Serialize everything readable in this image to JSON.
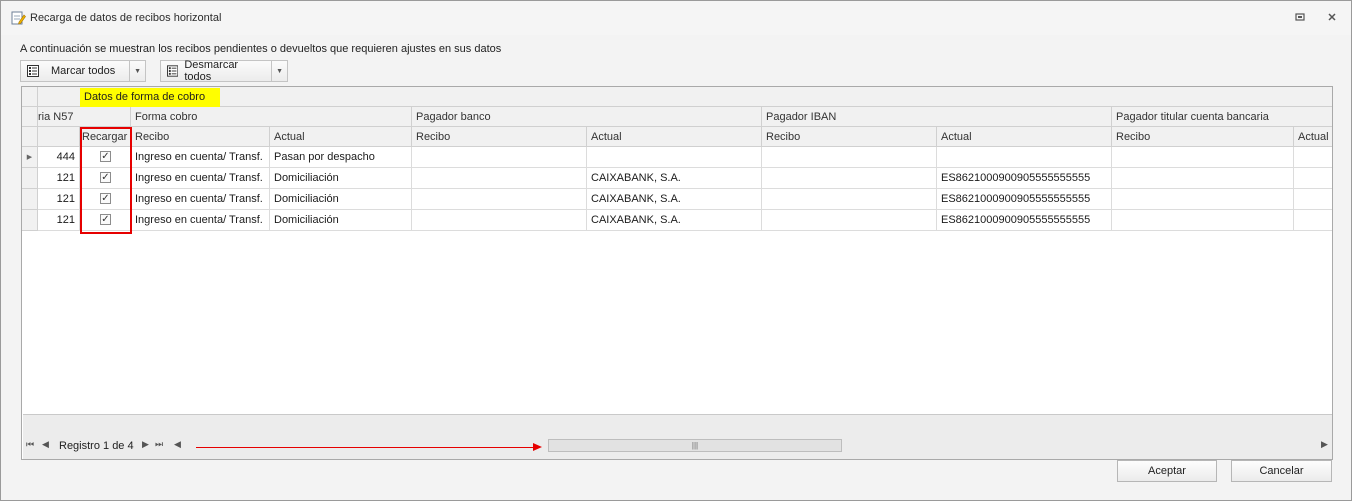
{
  "window": {
    "title": "Recarga de datos de recibos horizontal",
    "restore_icon": "restore-icon",
    "close_icon": "close-icon"
  },
  "intro_text": "A continuación se muestran los recibos pendientes o devueltos que requieren ajustes en sus datos",
  "toolbar": {
    "mark_all": "Marcar todos",
    "unmark_all": "Desmarcar todos",
    "list_icon": "checklist-icon",
    "dropdown_icon": "chevron-down-icon"
  },
  "grid": {
    "band_title": "Datos de forma de cobro",
    "band_highlight_color": "#fffe00",
    "group_headers": {
      "first": "ria N57",
      "forma_cobro": "Forma cobro",
      "pagador_banco": "Pagador banco",
      "pagador_iban": "Pagador IBAN",
      "pagador_titular": "Pagador titular cuenta bancaria"
    },
    "column_headers": {
      "recargar": "Recargar",
      "forma_recibo": "Recibo",
      "forma_actual": "Actual",
      "banco_recibo": "Recibo",
      "banco_actual": "Actual",
      "iban_recibo": "Recibo",
      "iban_actual": "Actual",
      "titular_recibo": "Recibo",
      "titular_actual": "Actual"
    },
    "rows": [
      {
        "n57": "444",
        "checked": true,
        "forma_recibo": "Ingreso en cuenta/ Transf.",
        "forma_actual": "Pasan por despacho",
        "banco_recibo": "",
        "banco_actual": "",
        "iban_recibo": "",
        "iban_actual": "",
        "titular_recibo": "",
        "titular_actual": ""
      },
      {
        "n57": "121",
        "checked": true,
        "forma_recibo": "Ingreso en cuenta/ Transf.",
        "forma_actual": "Domiciliación",
        "banco_recibo": "",
        "banco_actual": "CAIXABANK, S.A.",
        "iban_recibo": "",
        "iban_actual": "ES8621000900905555555555",
        "titular_recibo": "",
        "titular_actual": ""
      },
      {
        "n57": "121",
        "checked": true,
        "forma_recibo": "Ingreso en cuenta/ Transf.",
        "forma_actual": "Domiciliación",
        "banco_recibo": "",
        "banco_actual": "CAIXABANK, S.A.",
        "iban_recibo": "",
        "iban_actual": "ES8621000900905555555555",
        "titular_recibo": "",
        "titular_actual": ""
      },
      {
        "n57": "121",
        "checked": true,
        "forma_recibo": "Ingreso en cuenta/ Transf.",
        "forma_actual": "Domiciliación",
        "banco_recibo": "",
        "banco_actual": "CAIXABANK, S.A.",
        "iban_recibo": "",
        "iban_actual": "ES8621000900905555555555",
        "titular_recibo": "",
        "titular_actual": ""
      }
    ],
    "navigator": {
      "record_text": "Registro 1 de 4",
      "first_icon": "first-record-icon",
      "prev_icon": "previous-record-icon",
      "next_icon": "next-record-icon",
      "last_icon": "last-record-icon"
    },
    "annotation_color": "#e60000"
  },
  "buttons": {
    "accept": "Aceptar",
    "cancel": "Cancelar"
  }
}
